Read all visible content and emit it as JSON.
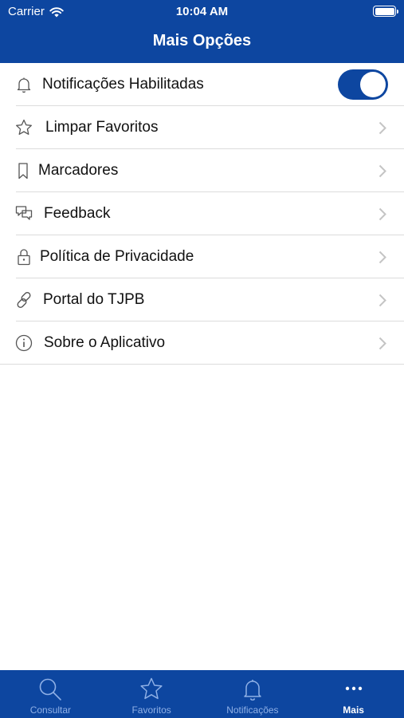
{
  "status_bar": {
    "carrier": "Carrier",
    "time": "10:04 AM"
  },
  "nav": {
    "title": "Mais Opções"
  },
  "options": [
    {
      "label": "Notificações Habilitadas",
      "icon": "bell-icon",
      "control": "toggle",
      "enabled": true
    },
    {
      "label": "Limpar Favoritos",
      "icon": "star-icon",
      "control": "chevron"
    },
    {
      "label": "Marcadores",
      "icon": "bookmark-icon",
      "control": "chevron"
    },
    {
      "label": "Feedback",
      "icon": "chat-bubbles-icon",
      "control": "chevron"
    },
    {
      "label": "Política de Privacidade",
      "icon": "lock-icon",
      "control": "chevron"
    },
    {
      "label": "Portal do TJPB",
      "icon": "link-icon",
      "control": "chevron"
    },
    {
      "label": "Sobre o Aplicativo",
      "icon": "info-icon",
      "control": "chevron"
    }
  ],
  "tabs": [
    {
      "label": "Consultar",
      "icon": "search-icon",
      "active": false
    },
    {
      "label": "Favoritos",
      "icon": "star-icon",
      "active": false
    },
    {
      "label": "Notificações",
      "icon": "bell-icon",
      "active": false
    },
    {
      "label": "Mais",
      "icon": "more-icon",
      "active": true
    }
  ],
  "colors": {
    "brand": "#0d46a0",
    "inactive_tab": "#8fb0e6",
    "divider": "#dcdcdc"
  }
}
